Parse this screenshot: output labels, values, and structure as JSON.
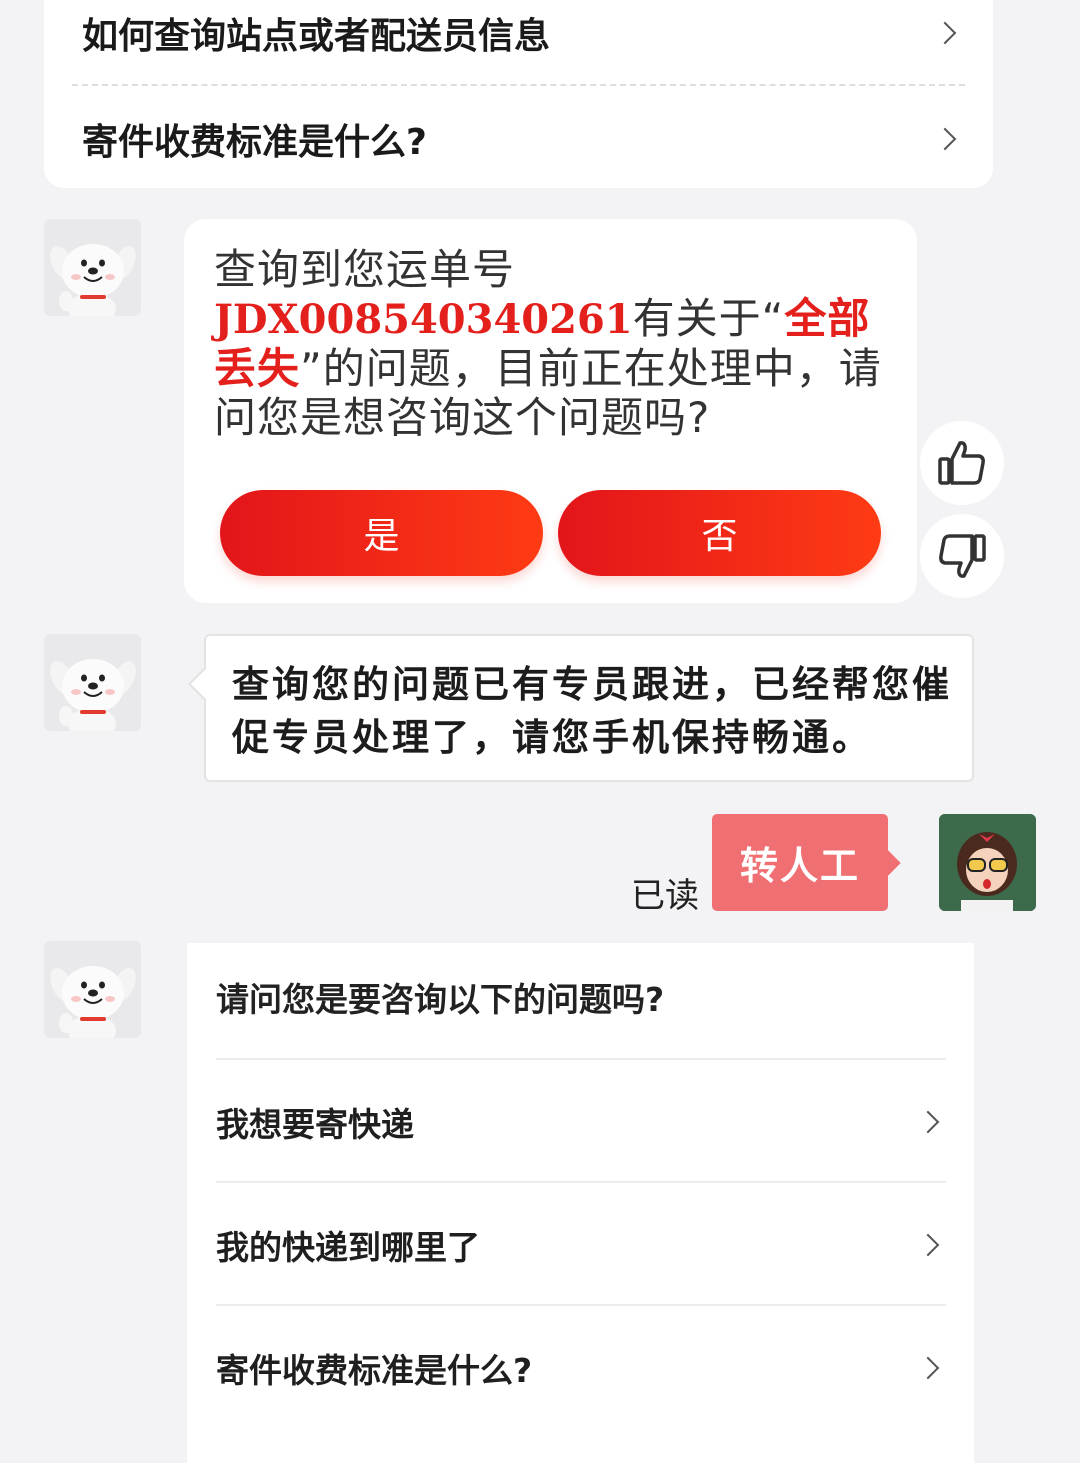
{
  "top_faq": {
    "items": [
      "如何查询站点或者配送员信息",
      "寄件收费标准是什么?"
    ]
  },
  "bot_message_1": {
    "text_before_waybill": "查询到您运单号",
    "waybill": "JDX008540340261",
    "text_mid_1": "有关于“",
    "issue": "全部丢失",
    "text_mid_2": "”的问题，目前正在处理中，请问您是想咨询这个问题吗?",
    "yes_label": "是",
    "no_label": "否"
  },
  "feedback": {
    "like_icon": "thumbs-up-icon",
    "dislike_icon": "thumbs-down-icon"
  },
  "bot_message_2": {
    "text": "查询您的问题已有专员跟进，已经帮您催促专员处理了，请您手机保持畅通。"
  },
  "user_message": {
    "status": "已读",
    "text": "转人工"
  },
  "bottom_faq": {
    "question": "请问您是要咨询以下的问题吗?",
    "items": [
      "我想要寄快递",
      "我的快递到哪里了",
      "寄件收费标准是什么?"
    ]
  },
  "colors": {
    "accent_red": "#e4201d",
    "user_bubble": "#ef6f73",
    "background": "#f3f3f5"
  }
}
